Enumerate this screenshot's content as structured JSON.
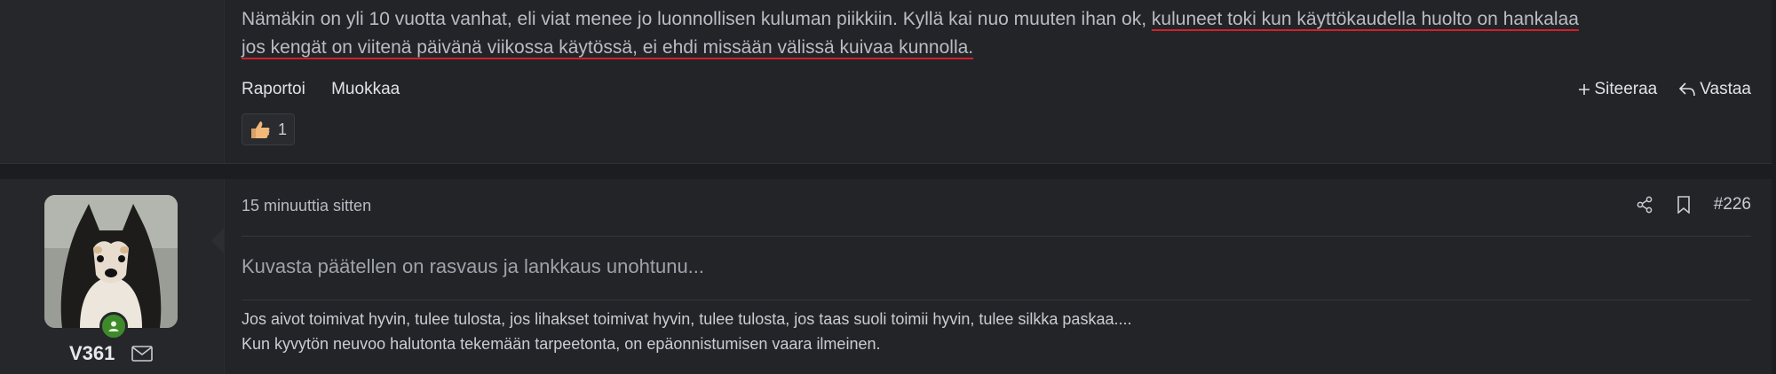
{
  "previous_post": {
    "message_plain": "Nämäkin on yli 10 vuotta vanhat, eli viat menee jo luonnollisen kuluman piikkiin. Kyllä kai nuo muuten ihan ok, ",
    "message_underlined_line1": "kuluneet toki kun käyttökaudella huolto on hankalaa",
    "message_underlined_line2": "jos kengät on viitenä päivänä viikossa käytössä, ei ehdi missään välissä kuivaa kunnolla.",
    "actions": {
      "report": "Raportoi",
      "edit": "Muokkaa",
      "quote": "Siteeraa",
      "reply": "Vastaa"
    },
    "reaction": {
      "emoji_name": "thumbs-up",
      "count": "1"
    }
  },
  "post": {
    "username": "V361",
    "timestamp": "15 minuuttia sitten",
    "post_number": "#226",
    "body": "Kuvasta päätellen on rasvaus ja lankkaus unohtunu...",
    "signature": [
      "Jos aivot toimivat hyvin, tulee tulosta, jos lihakset toimivat hyvin, tulee tulosta, jos taas suoli toimii hyvin, tulee silkka paskaa....",
      "Kun kyvytön neuvoo halutonta tekemään tarpeetonta, on epäonnistumisen vaara ilmeinen."
    ]
  },
  "colors": {
    "background": "#1c1d20",
    "post_bg": "#232428",
    "underline": "#d0202a",
    "online": "#3e8a2a"
  }
}
